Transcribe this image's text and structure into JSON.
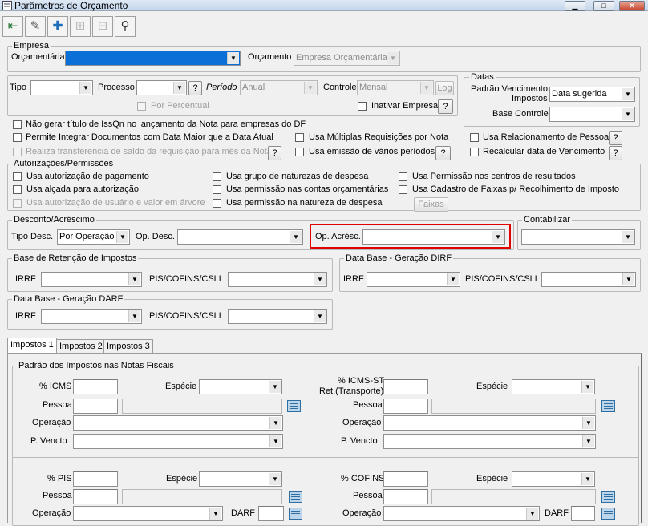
{
  "window": {
    "title": "Parâmetros de Orçamento",
    "minimize": "▁",
    "maximize": "□",
    "close": "✕"
  },
  "toolbar": {
    "icons": [
      "exit-icon",
      "edit-icon",
      "add-icon",
      "insert-row-icon",
      "remove-row-icon",
      "binoculars-icon"
    ]
  },
  "empresa": {
    "legend": "Empresa",
    "orcamentaria_label": "Orçamentária",
    "orcamentaria_value": "",
    "orcamento_label": "Orçamento",
    "orcamento_value": "Empresa Orçamentária"
  },
  "filtros": {
    "tipo_label": "Tipo",
    "processo_label": "Processo",
    "help": "?",
    "periodo_label": "Período",
    "periodo_value": "Anual",
    "controle_label": "Controle",
    "controle_value": "Mensal",
    "log_button": "Log",
    "por_percentual": "Por Percentual",
    "inativar_empresa": "Inativar Empresa"
  },
  "datas": {
    "legend": "Datas",
    "padrao_label_1": "Padrão Vencimento",
    "padrao_label_2": "Impostos",
    "padrao_value": "Data sugerida",
    "base_controle_label": "Base Controle",
    "base_controle_value": ""
  },
  "opcoes": {
    "nao_gerar": "Não gerar título de IssQn no lançamento da Nota para empresas do DF",
    "permite_integrar": "Permite Integrar Documentos com Data Maior que a Data Atual",
    "realiza_transferencia": "Realiza transferencia de saldo da requisição para mês da Nota",
    "usa_multiplas": "Usa Múltiplas Requisições por Nota",
    "usa_emissao": "Usa emissão de vários períodos",
    "usa_relacionamento": "Usa Relacionamento de Pessoa",
    "recalcular": "Recalcular data de Vencimento"
  },
  "autorizacoes": {
    "legend": "Autorizações/Permissões",
    "items": [
      "Usa autorização de pagamento",
      "Usa alçada para autorização",
      "Usa autorização de usuário e valor em árvore",
      "Usa grupo de naturezas de despesa",
      "Usa permissão nas contas orçamentárias",
      "Usa permissão na natureza de despesa",
      "Usa Permissão nos centros de resultados",
      "Usa Cadastro de Faixas p/ Recolhimento de Imposto"
    ],
    "faixas_button": "Faixas"
  },
  "desconto": {
    "legend": "Desconto/Acréscimo",
    "tipo_desc_label": "Tipo Desc.",
    "tipo_desc_value": "Por Operação",
    "op_desc_label": "Op. Desc.",
    "op_acresc_label": "Op. Acrésc."
  },
  "contabilizar": {
    "legend": "Contabilizar"
  },
  "base_retencao": {
    "legend": "Base de Retenção de Impostos",
    "irrf": "IRRF",
    "pis": "PIS/COFINS/CSLL"
  },
  "dirf": {
    "legend": "Data Base - Geração DIRF",
    "irrf": "IRRF",
    "pis": "PIS/COFINS/CSLL"
  },
  "darf": {
    "legend": "Data Base - Geração DARF",
    "irrf": "IRRF",
    "pis": "PIS/COFINS/CSLL"
  },
  "tabs": [
    "Impostos 1",
    "Impostos 2",
    "Impostos 3"
  ],
  "impostos": {
    "legend": "Padrão dos Impostos nas Notas Fiscais",
    "icms": "% ICMS",
    "icms_st_1": "% ICMS-ST",
    "icms_st_2": "Ret.(Transporte)",
    "especie": "Espécie",
    "pessoa": "Pessoa",
    "operacao": "Operação",
    "p_vencto": "P. Vencto",
    "pis": "% PIS",
    "cofins": "% COFINS",
    "darf": "DARF"
  }
}
